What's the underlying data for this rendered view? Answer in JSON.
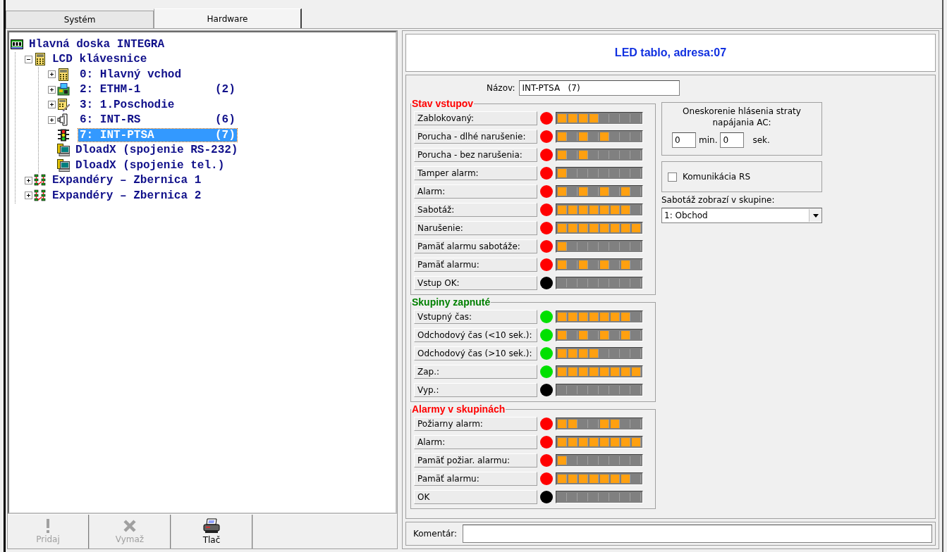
{
  "tabs": [
    {
      "label": "Systém",
      "selected": false
    },
    {
      "label": "Hardware",
      "selected": true
    }
  ],
  "tree": [
    {
      "label": "Hlavná doska INTEGRA",
      "kind": "board",
      "selected": false,
      "children": [
        {
          "label": "LCD klávesnice",
          "kind": "keypad",
          "expanded": true,
          "selected": false,
          "children": [
            {
              "label": "0: Hlavný vchod",
              "kind": "keypad",
              "expanded": false,
              "selected": false
            },
            {
              "label": "2: ETHM-1",
              "count": "(2)",
              "kind": "ethernet",
              "expanded": false,
              "selected": false
            },
            {
              "label": "3: 1.Poschodie",
              "kind": "keypad-pen",
              "expanded": false,
              "selected": false
            },
            {
              "label": "6: INT-RS",
              "count": "(6)",
              "kind": "connector",
              "expanded": false,
              "selected": false
            },
            {
              "label": "7: INT-PTSA",
              "count": "(7)",
              "kind": "traffic-light",
              "selected": true
            },
            {
              "label": "DloadX (spojenie RS-232)",
              "kind": "computer",
              "selected": false
            },
            {
              "label": "DloadX (spojenie tel.)",
              "kind": "computer",
              "selected": false
            }
          ]
        },
        {
          "label": "Expandéry – Zbernica 1",
          "kind": "expander",
          "expanded": false,
          "selected": false
        },
        {
          "label": "Expandéry – Zbernica 2",
          "kind": "expander",
          "expanded": false,
          "selected": false
        }
      ]
    }
  ],
  "toolbar": [
    {
      "label": "Pridaj",
      "kind": "add",
      "disabled": true
    },
    {
      "label": "Vymaž",
      "kind": "delete",
      "disabled": true
    },
    {
      "label": "Tlač",
      "kind": "print",
      "disabled": false
    }
  ],
  "header": "LED tablo, adresa:07",
  "name_field": {
    "label": "Názov:",
    "value": "INT-PTSA   (7)"
  },
  "groups": [
    {
      "title": "Stav vstupov",
      "color": "#ff0000",
      "rows": [
        {
          "label": "Zablokovaný:",
          "color": "#ff0000",
          "segments": [
            true,
            true,
            true,
            true,
            false,
            false,
            false,
            false
          ]
        },
        {
          "label": "Porucha - dlhé narušenie:",
          "color": "#ff0000",
          "segments": [
            true,
            false,
            true,
            false,
            true,
            false,
            false,
            false
          ]
        },
        {
          "label": "Porucha - bez narušenia:",
          "color": "#ff0000",
          "segments": [
            true,
            false,
            true,
            false,
            false,
            false,
            false,
            false
          ]
        },
        {
          "label": "Tamper alarm:",
          "color": "#ff0000",
          "segments": [
            true,
            false,
            false,
            false,
            false,
            false,
            false,
            false
          ]
        },
        {
          "label": "Alarm:",
          "color": "#ff0000",
          "segments": [
            true,
            false,
            true,
            false,
            true,
            false,
            true,
            false
          ]
        },
        {
          "label": "Sabotáž:",
          "color": "#ff0000",
          "segments": [
            true,
            true,
            true,
            true,
            true,
            true,
            true,
            false
          ]
        },
        {
          "label": "Narušenie:",
          "color": "#ff0000",
          "segments": [
            true,
            true,
            true,
            true,
            true,
            true,
            true,
            true
          ]
        },
        {
          "label": "Pamäť alarmu sabotáže:",
          "color": "#ff0000",
          "segments": [
            true,
            false,
            false,
            false,
            false,
            false,
            false,
            false
          ]
        },
        {
          "label": "Pamäť alarmu:",
          "color": "#ff0000",
          "segments": [
            true,
            false,
            true,
            false,
            true,
            false,
            true,
            false
          ]
        },
        {
          "label": "Vstup OK:",
          "color": "#000000",
          "segments": [
            false,
            false,
            false,
            false,
            false,
            false,
            false,
            false
          ]
        }
      ]
    },
    {
      "title": "Skupiny zapnuté",
      "color": "#008000",
      "rows": [
        {
          "label": "Vstupný čas:",
          "color": "#00e000",
          "segments": [
            true,
            true,
            true,
            true,
            true,
            true,
            true,
            false
          ]
        },
        {
          "label": "Odchodový čas (<10 sek.):",
          "color": "#00e000",
          "segments": [
            true,
            false,
            true,
            false,
            true,
            false,
            true,
            false
          ]
        },
        {
          "label": "Odchodový čas (>10 sek.):",
          "color": "#00e000",
          "segments": [
            true,
            true,
            true,
            true,
            false,
            false,
            false,
            false
          ]
        },
        {
          "label": "Zap.:",
          "color": "#00e000",
          "segments": [
            true,
            true,
            true,
            true,
            true,
            true,
            true,
            true
          ]
        },
        {
          "label": "Vyp.:",
          "color": "#000000",
          "segments": [
            false,
            false,
            false,
            false,
            false,
            false,
            false,
            false
          ]
        }
      ]
    },
    {
      "title": "Alarmy v skupinách",
      "color": "#ff0000",
      "rows": [
        {
          "label": "Požiarny alarm:",
          "color": "#ff0000",
          "segments": [
            true,
            true,
            false,
            false,
            true,
            true,
            false,
            false
          ]
        },
        {
          "label": "Alarm:",
          "color": "#ff0000",
          "segments": [
            true,
            true,
            true,
            true,
            true,
            true,
            true,
            true
          ]
        },
        {
          "label": "Pamäť požiar. alarmu:",
          "color": "#ff0000",
          "segments": [
            true,
            false,
            false,
            false,
            false,
            false,
            false,
            false
          ]
        },
        {
          "label": "Pamäť alarmu:",
          "color": "#ff0000",
          "segments": [
            true,
            true,
            true,
            true,
            true,
            true,
            true,
            false
          ]
        },
        {
          "label": "OK",
          "color": "#000000",
          "segments": [
            false,
            false,
            false,
            false,
            false,
            false,
            false,
            false
          ]
        }
      ]
    }
  ],
  "ac_delay": {
    "title": "Oneskorenie hlásenia straty napájania AC:",
    "minutes": "0",
    "minutes_unit": "min.",
    "seconds": "0",
    "seconds_unit": "sek."
  },
  "rs_checkbox": {
    "label": "Komunikácia RS",
    "checked": false
  },
  "tamper_group": {
    "label": "Sabotáž zobrazí v skupine:",
    "value": "1: Obchod"
  },
  "comment": {
    "label": "Komentár:"
  }
}
